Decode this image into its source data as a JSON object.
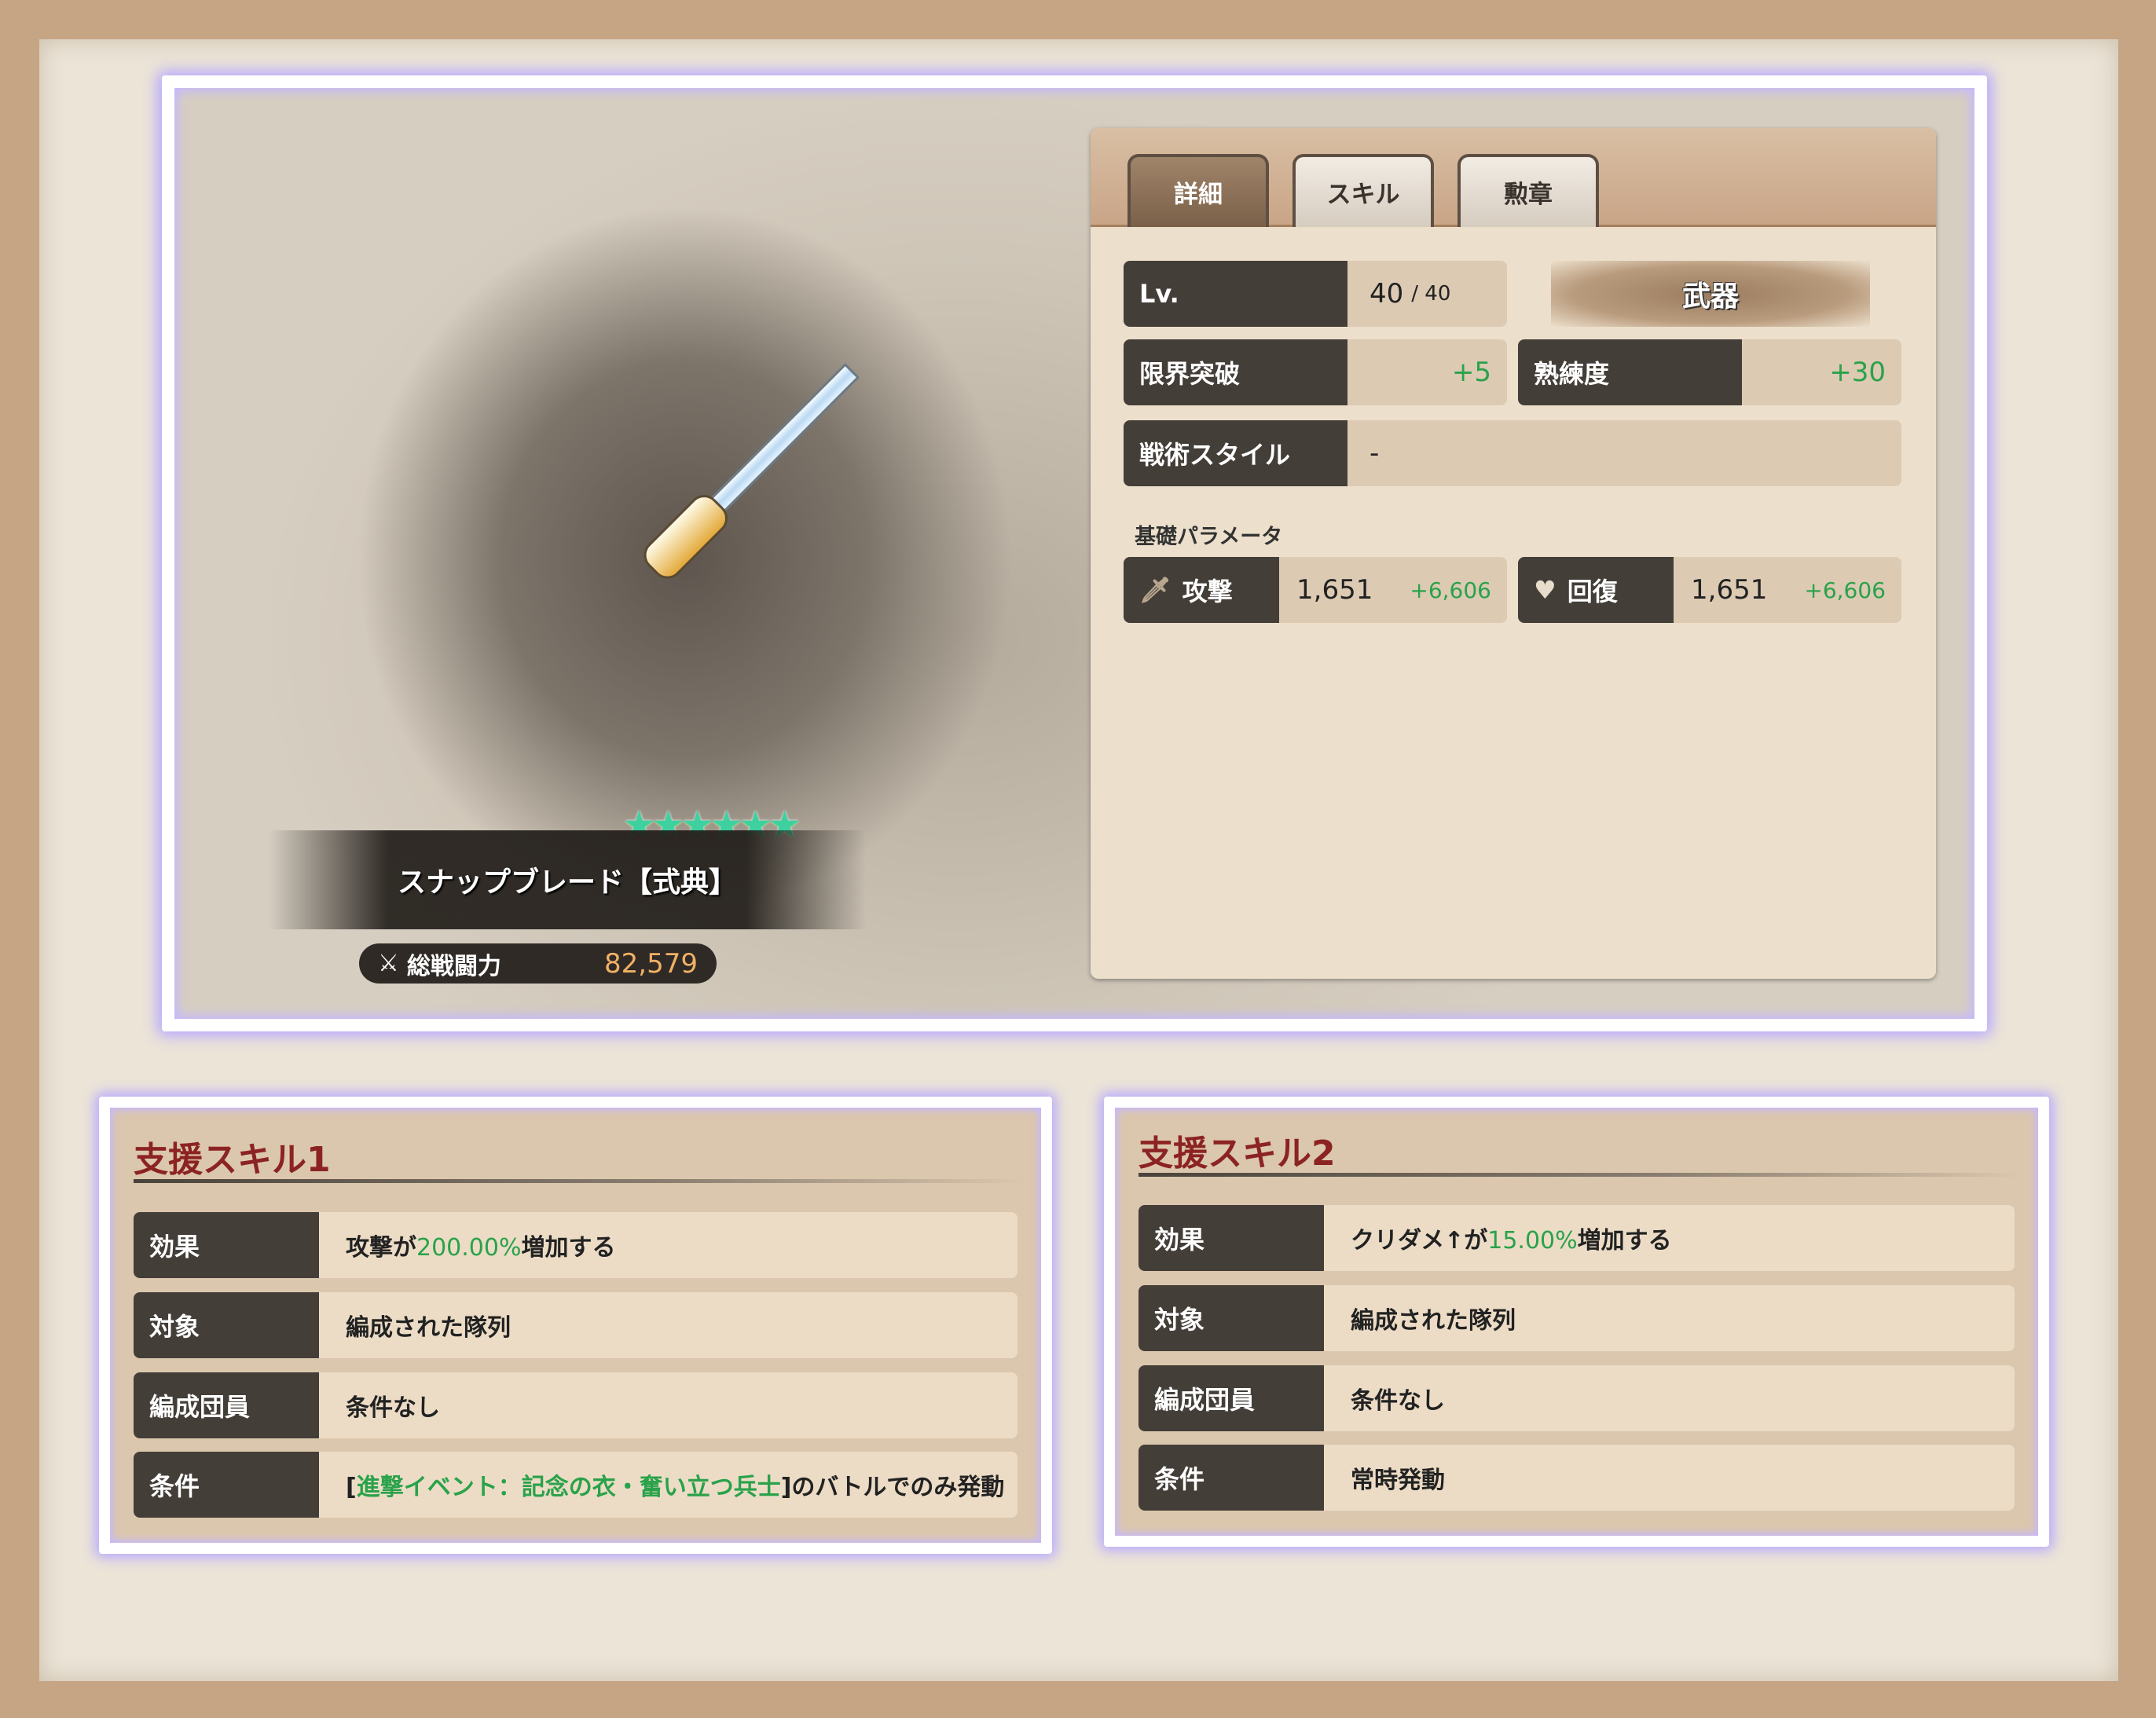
{
  "item": {
    "name": "スナップブレード【式典】",
    "rarity_stars": 6,
    "power_label": "総戦闘力",
    "power_value": "82,579"
  },
  "tabs": [
    "詳細",
    "スキル",
    "勲章"
  ],
  "active_tab": 0,
  "details": {
    "level_label": "Lv.",
    "level_value": "40",
    "level_max": "/ 40",
    "category": "武器",
    "limit_break_label": "限界突破",
    "limit_break_value": "+5",
    "proficiency_label": "熟練度",
    "proficiency_value": "+30",
    "tactic_label": "戦術スタイル",
    "tactic_value": "-",
    "base_params_label": "基礎パラメータ",
    "attack_label": "攻撃",
    "attack_value": "1,651",
    "attack_bonus": "+6,606",
    "heal_label": "回復",
    "heal_value": "1,651",
    "heal_bonus": "+6,606"
  },
  "support_skills": [
    {
      "title": "支援スキル1",
      "rows": {
        "effect_label": "効果",
        "effect_pre": "攻撃が",
        "effect_num": "200.00%",
        "effect_post": "増加する",
        "target_label": "対象",
        "target_value": "編成された隊列",
        "member_label": "編成団員",
        "member_value": "条件なし",
        "cond_label": "条件",
        "cond_open": "[",
        "cond_event": "進撃イベント：記念の衣・奮い立つ兵士",
        "cond_close": "]のバトルでのみ発動"
      }
    },
    {
      "title": "支援スキル2",
      "rows": {
        "effect_label": "効果",
        "effect_pre": "クリダメ↑が",
        "effect_num": "15.00%",
        "effect_post": "増加する",
        "target_label": "対象",
        "target_value": "編成された隊列",
        "member_label": "編成団員",
        "member_value": "条件なし",
        "cond_label": "条件",
        "cond_value": "常時発動"
      }
    }
  ],
  "colors": {
    "accent_green": "#2aa24a",
    "title_red": "#8c2323",
    "label_dark": "#443e38",
    "power_orange": "#f1b165"
  }
}
